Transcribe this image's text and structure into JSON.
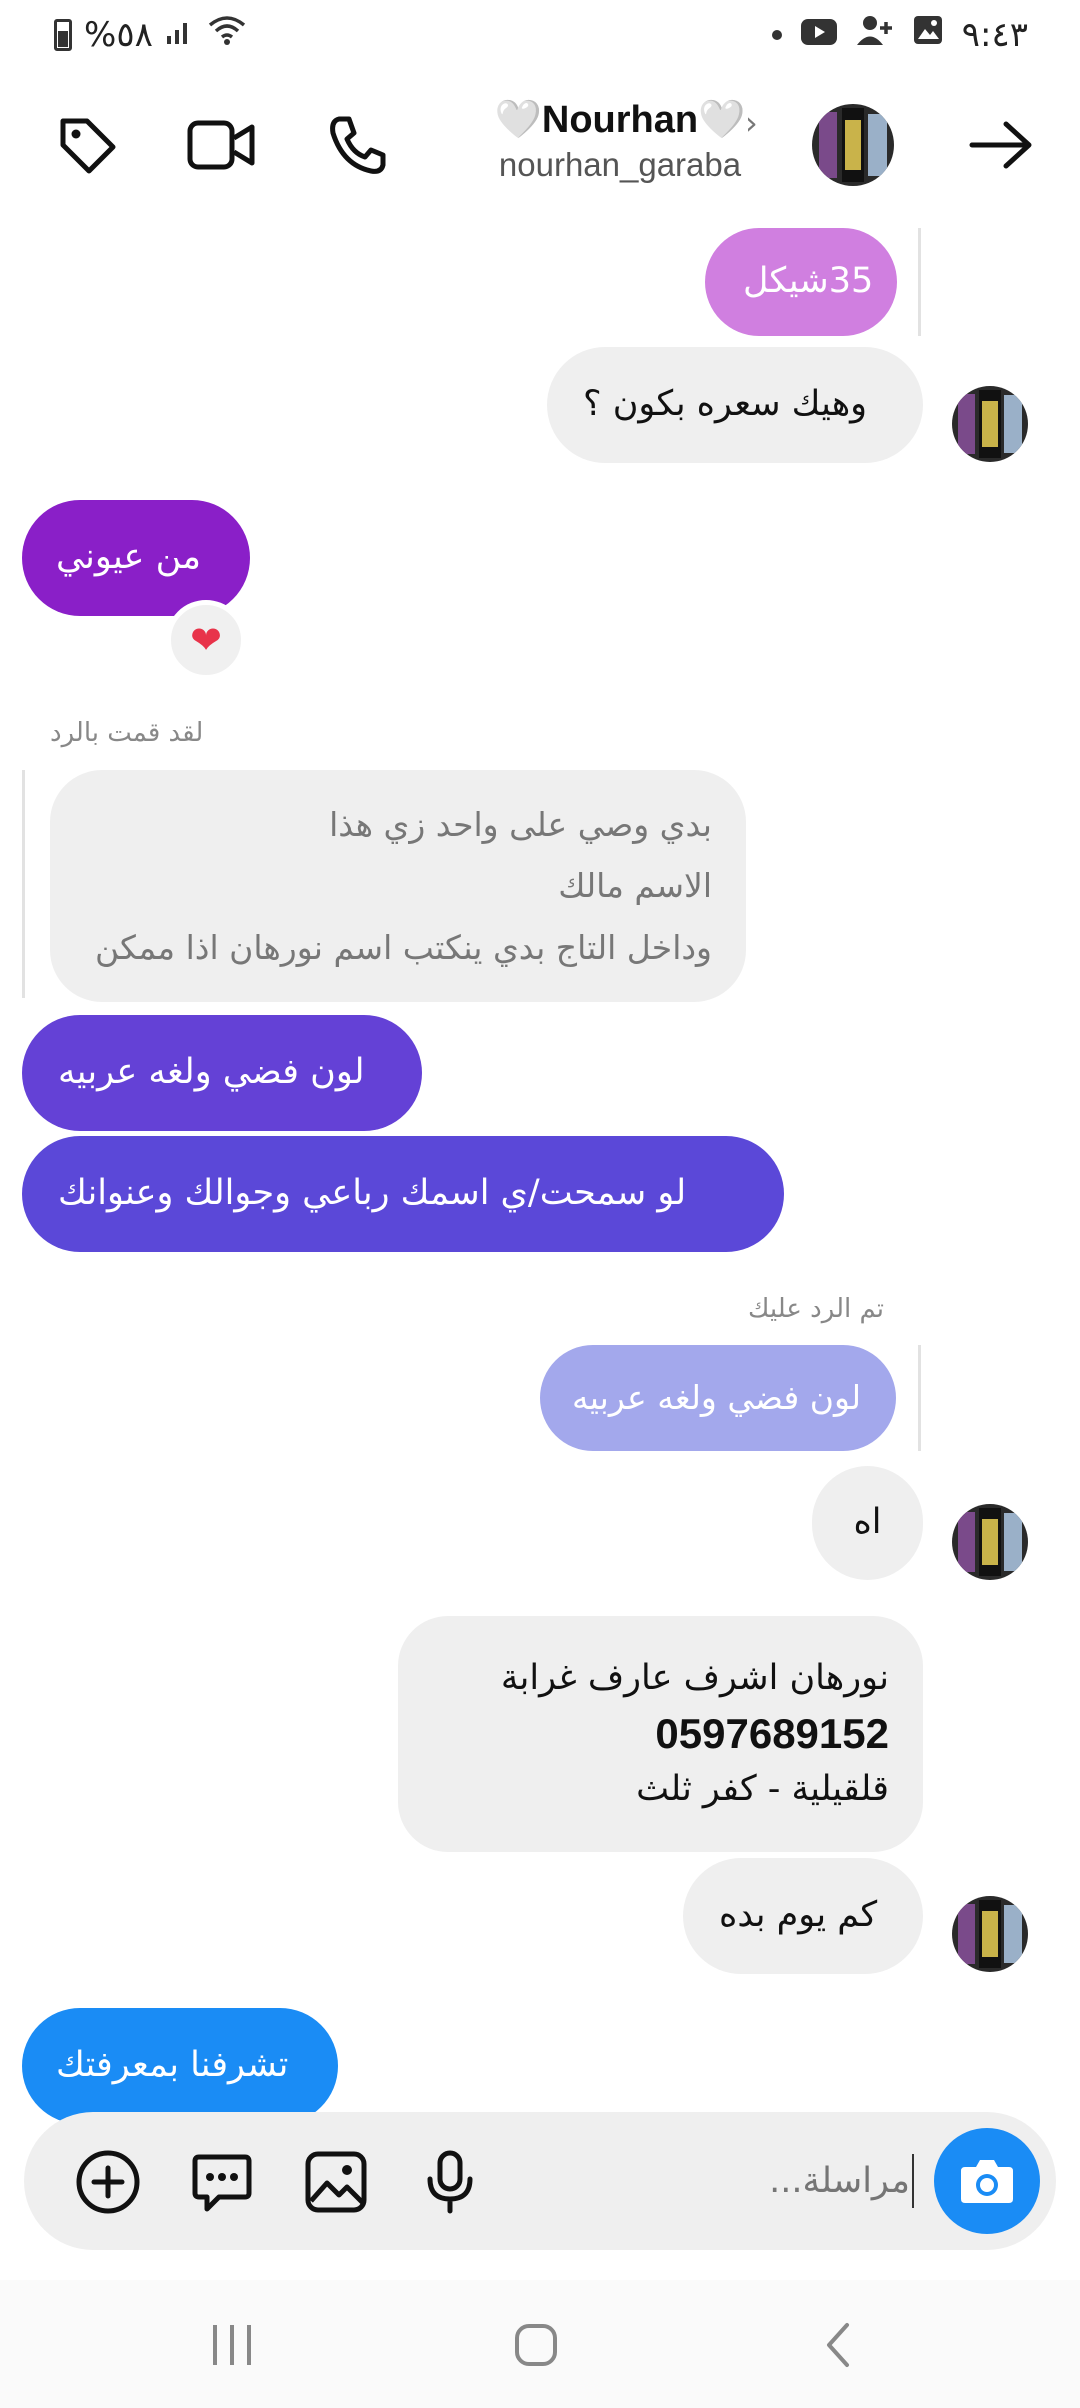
{
  "status_bar": {
    "time": "٩:٤٣",
    "battery_text": "%٥٨"
  },
  "header": {
    "title": "🤍Nourhan🤍",
    "username": "nourhan_garaba"
  },
  "messages": {
    "m1": "35شيكل",
    "m2": "وهيك سعره بكون ؟",
    "m3": "من عيوني",
    "m3_reaction": "❤️",
    "reply_label_1": "لقد قمت بالرد",
    "quoted_1_line1": "بدي وصي على واحد زي هذا",
    "quoted_1_line2": "الاسم مالك",
    "quoted_1_line3": "وداخل التاج بدي ينكتب اسم نورهان اذا ممكن",
    "m4": "لون فضي ولغه عربيه",
    "m5": "لو سمحت/ي اسمك رباعي وجوالك وعنوانك",
    "reply_label_2": "تم الرد عليك",
    "quoted_2": "لون فضي ولغه عربيه",
    "m6": "اه",
    "m7_line1": "نورهان  اشرف عارف   غرابة",
    "m7_line2": "0597689152",
    "m7_line3": "قلقيلية - كفر ثلث",
    "m8": "كم يوم بده",
    "m9": "تشرفنا بمعرفتك"
  },
  "composer": {
    "placeholder": "مراسلة..."
  },
  "colors": {
    "pink_bubble": "#d07fe0",
    "purple_bubble": "#8a1fc8",
    "indigo_bubble": "#6441d6",
    "indigo_bubble_2": "#5b48d8",
    "reply_bubble": "#a3a8ec",
    "blue_bubble": "#1a8cf5",
    "camera_button": "#1a8cf5"
  }
}
